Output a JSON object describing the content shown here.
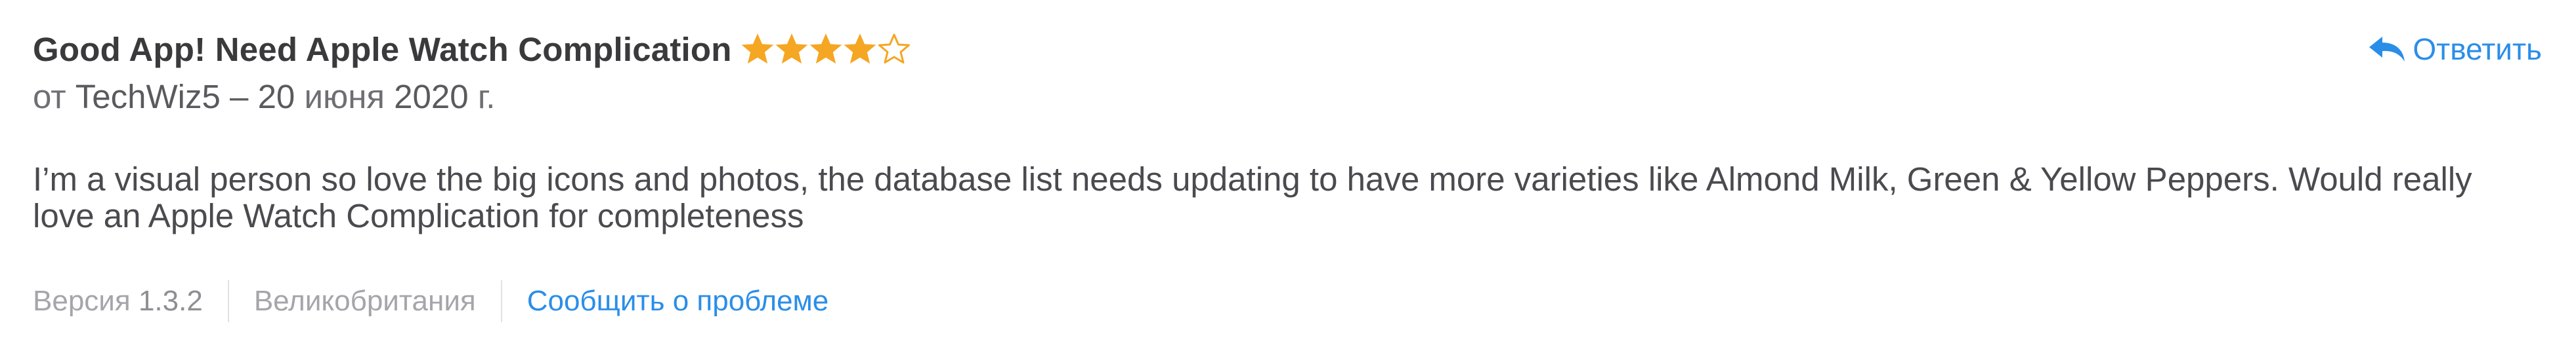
{
  "review": {
    "title": "Good App! Need Apple Watch Complication",
    "rating": 4,
    "rating_max": 5,
    "star_color": "#f5a623",
    "byline_prefix": "от",
    "author": "TechWiz5",
    "separator": "–",
    "date_day": "20",
    "date_month": "июня",
    "date_year": "2020",
    "date_suffix": "г.",
    "body": "I’m a visual person so love the big icons and photos, the database list needs updating to have more varieties like Almond Milk, Green & Yellow Peppers. Would really love an Apple Watch Complication for completeness"
  },
  "reply": {
    "label": "Ответить",
    "icon": "reply-arrow-icon",
    "color": "#2a8ee8"
  },
  "footer": {
    "version_label": "Версия",
    "version": "1.3.2",
    "country": "Великобритания",
    "report_label": "Сообщить о проблеме",
    "link_color": "#2a8ee8"
  }
}
